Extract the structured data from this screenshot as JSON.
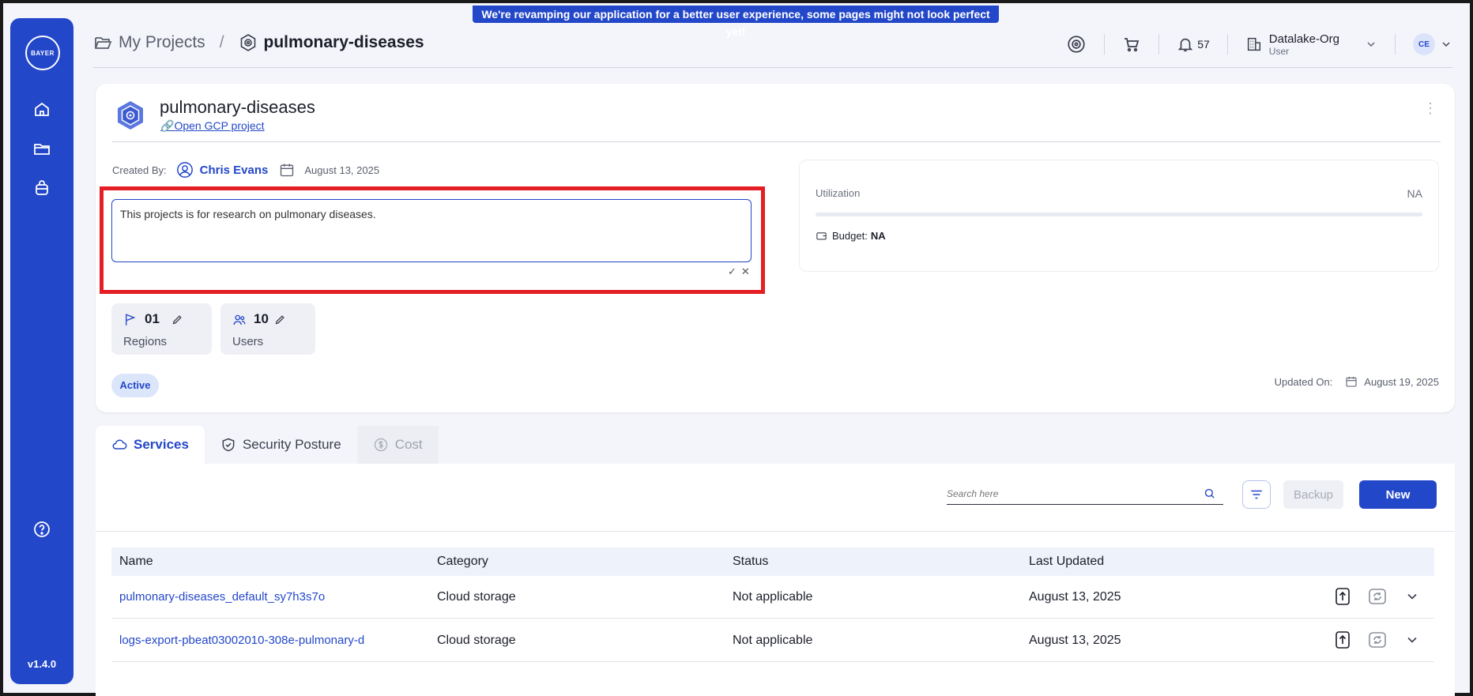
{
  "banner": "We're revamping our application for a better user experience, some pages might not look perfect yet!",
  "sidebar": {
    "logo_h": "BAYER",
    "logo_v": "BAYER",
    "version": "v1.4.0"
  },
  "header": {
    "crumb_root": "My Projects",
    "crumb_sep": "/",
    "crumb_current": "pulmonary-diseases",
    "notifications": "57",
    "org_name": "Datalake-Org",
    "org_role": "User",
    "avatar": "CE"
  },
  "project": {
    "title": "pulmonary-diseases",
    "gcp_link": "Open GCP project",
    "created_by_label": "Created By:",
    "created_by": "Chris Evans",
    "created_date": "August 13, 2025",
    "description": "This projects is for research on pulmonary diseases.",
    "regions_value": "01",
    "regions_label": "Regions",
    "users_value": "10",
    "users_label": "Users",
    "status": "Active",
    "updated_label": "Updated On:",
    "updated_date": "August 19, 2025",
    "utilization_label": "Utilization",
    "utilization_value": "NA",
    "budget_label": "Budget:",
    "budget_value": "NA"
  },
  "tabs": [
    {
      "label": "Services"
    },
    {
      "label": "Security Posture"
    },
    {
      "label": "Cost"
    }
  ],
  "services": {
    "search_placeholder": "Search here",
    "backup_label": "Backup",
    "new_label": "New",
    "columns": [
      "Name",
      "Category",
      "Status",
      "Last Updated"
    ],
    "rows": [
      {
        "name": "pulmonary-diseases_default_sy7h3s7o",
        "category": "Cloud storage",
        "status": "Not applicable",
        "updated": "August 13, 2025"
      },
      {
        "name": "logs-export-pbeat03002010-308e-pulmonary-d",
        "category": "Cloud storage",
        "status": "Not applicable",
        "updated": "August 13, 2025"
      }
    ]
  },
  "colors": {
    "brand": "#2347c9",
    "highlight": "#e31e24"
  }
}
